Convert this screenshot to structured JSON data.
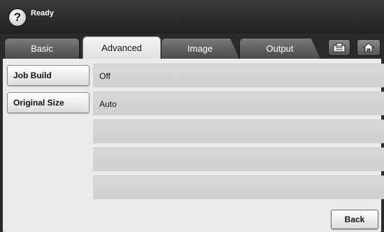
{
  "status": {
    "help_glyph": "?",
    "text": "Ready"
  },
  "tabs": [
    {
      "label": "Basic",
      "selected": false
    },
    {
      "label": "Advanced",
      "selected": true
    },
    {
      "label": "Image",
      "selected": false
    },
    {
      "label": "Output",
      "selected": false
    }
  ],
  "toolbar_icons": [
    "job-status-icon",
    "home-icon"
  ],
  "settings": [
    {
      "label": "Job Build",
      "value": "Off"
    },
    {
      "label": "Original Size",
      "value": "Auto"
    }
  ],
  "empty_rows": 3,
  "footer": {
    "back_label": "Back"
  }
}
